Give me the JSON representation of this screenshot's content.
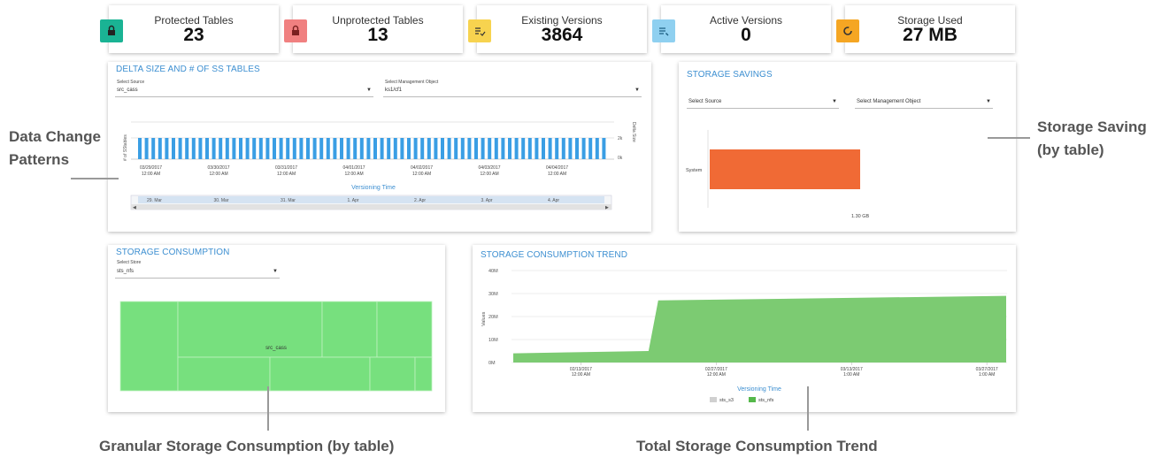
{
  "stats": [
    {
      "label": "Protected Tables",
      "value": "23",
      "color": "#1ab394",
      "icon": "lock-icon"
    },
    {
      "label": "Unprotected Tables",
      "value": "13",
      "color": "#f08080",
      "icon": "unlock-icon"
    },
    {
      "label": "Existing Versions",
      "value": "3864",
      "color": "#f7d34f",
      "icon": "list-check-icon"
    },
    {
      "label": "Active Versions",
      "value": "0",
      "color": "#8fd0f0",
      "icon": "list-edit-icon"
    },
    {
      "label": "Storage Used",
      "value": "27 MB",
      "color": "#f5a623",
      "icon": "storage-ring-icon"
    }
  ],
  "delta_panel": {
    "title": "DELTA SIZE AND # OF SS TABLES",
    "source_label": "Select Source",
    "source_value": "src_cass",
    "object_label": "Select Management Object",
    "object_value": "ks1/cf1",
    "y_left_label": "# of SStables",
    "y_right_label": "Delta Size",
    "y_right_ticks": [
      "2k",
      "0k"
    ],
    "x_ticks": [
      {
        "date": "03/29/2017",
        "time": "12:00 AM"
      },
      {
        "date": "03/30/2017",
        "time": "12:00 AM"
      },
      {
        "date": "03/31/2017",
        "time": "12:00 AM"
      },
      {
        "date": "04/01/2017",
        "time": "12:00 AM"
      },
      {
        "date": "04/02/2017",
        "time": "12:00 AM"
      },
      {
        "date": "04/03/2017",
        "time": "12:00 AM"
      },
      {
        "date": "04/04/2017",
        "time": "12:00 AM"
      }
    ],
    "x_title": "Versioning Time",
    "navigator_ticks": [
      "29. Mar",
      "30. Mar",
      "31. Mar",
      "1. Apr",
      "2. Apr",
      "3. Apr",
      "4. Apr"
    ],
    "bar_color": "#3a9ee4"
  },
  "savings_panel": {
    "title": "STORAGE SAVINGS",
    "source_placeholder": "Select Source",
    "object_placeholder": "Select Management Object",
    "bar_label": "System",
    "bar_value_label": "1.30 GB",
    "bar_color": "#f06a35"
  },
  "consumption_panel": {
    "title": "STORAGE CONSUMPTION",
    "store_label": "Select Store",
    "store_value": "sts_nfs",
    "treemap_label": "src_cass",
    "treemap_color": "#77e07e"
  },
  "trend_panel": {
    "title": "STORAGE CONSUMPTION TREND",
    "y_label": "Values",
    "y_ticks": [
      "40M",
      "30M",
      "20M",
      "10M",
      "0M"
    ],
    "x_ticks": [
      {
        "date": "02/13/2017",
        "time": "12:00 AM"
      },
      {
        "date": "02/27/2017",
        "time": "12:00 AM"
      },
      {
        "date": "03/13/2017",
        "time": "1:00 AM"
      },
      {
        "date": "03/27/2017",
        "time": "1:00 AM"
      }
    ],
    "x_title": "Versioning Time",
    "legend": [
      {
        "name": "sts_s3",
        "color": "#d0d0d0"
      },
      {
        "name": "sts_nfs",
        "color": "#55b84a"
      }
    ],
    "area_color": "#7ccb72"
  },
  "annotations": {
    "data_change": "Data Change Patterns",
    "storage_saving": "Storage Saving (by table)",
    "granular": "Granular Storage Consumption (by table)",
    "total_trend": "Total Storage Consumption Trend"
  },
  "chart_data": [
    {
      "type": "area",
      "title": "STORAGE CONSUMPTION TREND",
      "xlabel": "Versioning Time",
      "ylabel": "Values",
      "ylim": [
        0,
        40
      ],
      "x": [
        "02/06/2017",
        "02/20/2017",
        "02/21/2017",
        "03/29/2017"
      ],
      "series": [
        {
          "name": "sts_nfs",
          "values": [
            4,
            5,
            27,
            29
          ]
        },
        {
          "name": "sts_s3",
          "values": [
            0,
            0,
            0,
            0
          ]
        }
      ],
      "grid": true,
      "legend": "bottom"
    },
    {
      "type": "bar",
      "title": "STORAGE SAVINGS",
      "categories": [
        "System"
      ],
      "values": [
        1.3
      ],
      "xlabel": "",
      "ylabel": ""
    }
  ]
}
